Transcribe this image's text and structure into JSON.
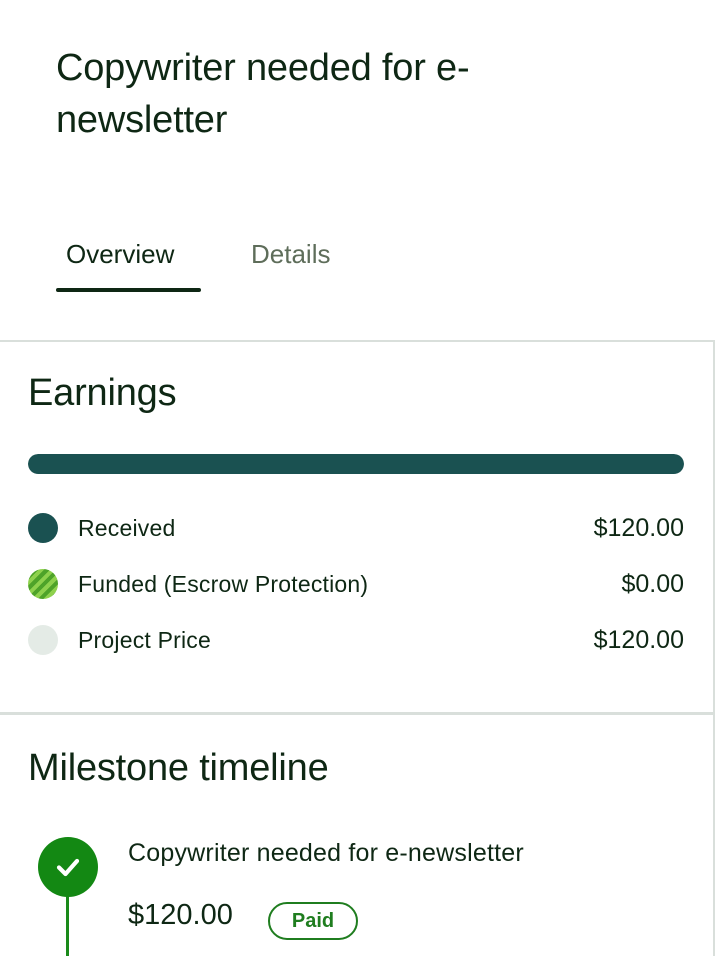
{
  "header": {
    "title": "Copywriter needed for e-newsletter",
    "tabs": [
      {
        "label": "Overview",
        "active": true
      },
      {
        "label": "Details",
        "active": false
      }
    ]
  },
  "earnings": {
    "title": "Earnings",
    "progress_received_fraction": 1.0,
    "legend": [
      {
        "label": "Received",
        "amount": "$120.00",
        "color": "#1a5151"
      },
      {
        "label": "Funded (Escrow Protection)",
        "amount": "$0.00",
        "color": "#6dbb3a"
      },
      {
        "label": "Project Price",
        "amount": "$120.00",
        "color": "#e4ebe6"
      }
    ]
  },
  "milestones": {
    "title": "Milestone timeline",
    "items": [
      {
        "name": "Copywriter needed for e-newsletter",
        "amount": "$120.00",
        "status": "Paid",
        "icon": "check-icon"
      }
    ]
  }
}
